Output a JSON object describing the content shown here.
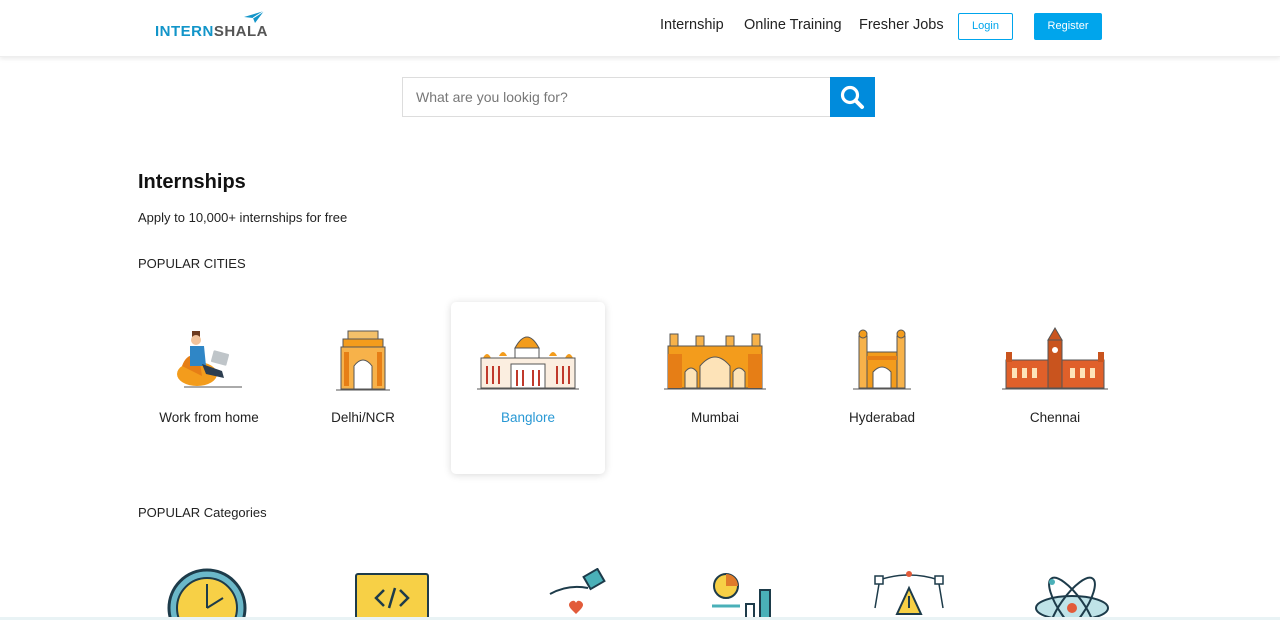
{
  "brand": {
    "part1": "INTERN",
    "part2": "SHALA"
  },
  "nav": {
    "internship": "Internship",
    "online_training": "Online Training",
    "fresher_jobs": "Fresher Jobs",
    "login": "Login",
    "register": "Register"
  },
  "search": {
    "placeholder": "What are you lookig for?",
    "icon": "search-icon"
  },
  "hero": {
    "title": "Internships",
    "subtitle": "Apply to 10,000+ internships for free"
  },
  "popular_cities": {
    "label": "POPULAR CITIES",
    "items": [
      {
        "name": "Work from home",
        "icon": "work-from-home-icon"
      },
      {
        "name": "Delhi/NCR",
        "icon": "india-gate-icon"
      },
      {
        "name": "Banglore",
        "icon": "vidhana-soudha-icon",
        "active": true
      },
      {
        "name": "Mumbai",
        "icon": "gateway-of-india-icon"
      },
      {
        "name": "Hyderabad",
        "icon": "charminar-icon"
      },
      {
        "name": "Chennai",
        "icon": "chennai-central-icon"
      }
    ]
  },
  "popular_categories": {
    "label": "POPULAR Categories",
    "items": [
      {
        "icon": "clock-icon"
      },
      {
        "icon": "code-icon"
      },
      {
        "icon": "hand-heart-icon"
      },
      {
        "icon": "chart-icon"
      },
      {
        "icon": "design-pen-icon"
      },
      {
        "icon": "atom-icon"
      }
    ]
  },
  "colors": {
    "accent": "#00a5ec",
    "search_button": "#008bdc",
    "active_city": "#2898d4"
  }
}
